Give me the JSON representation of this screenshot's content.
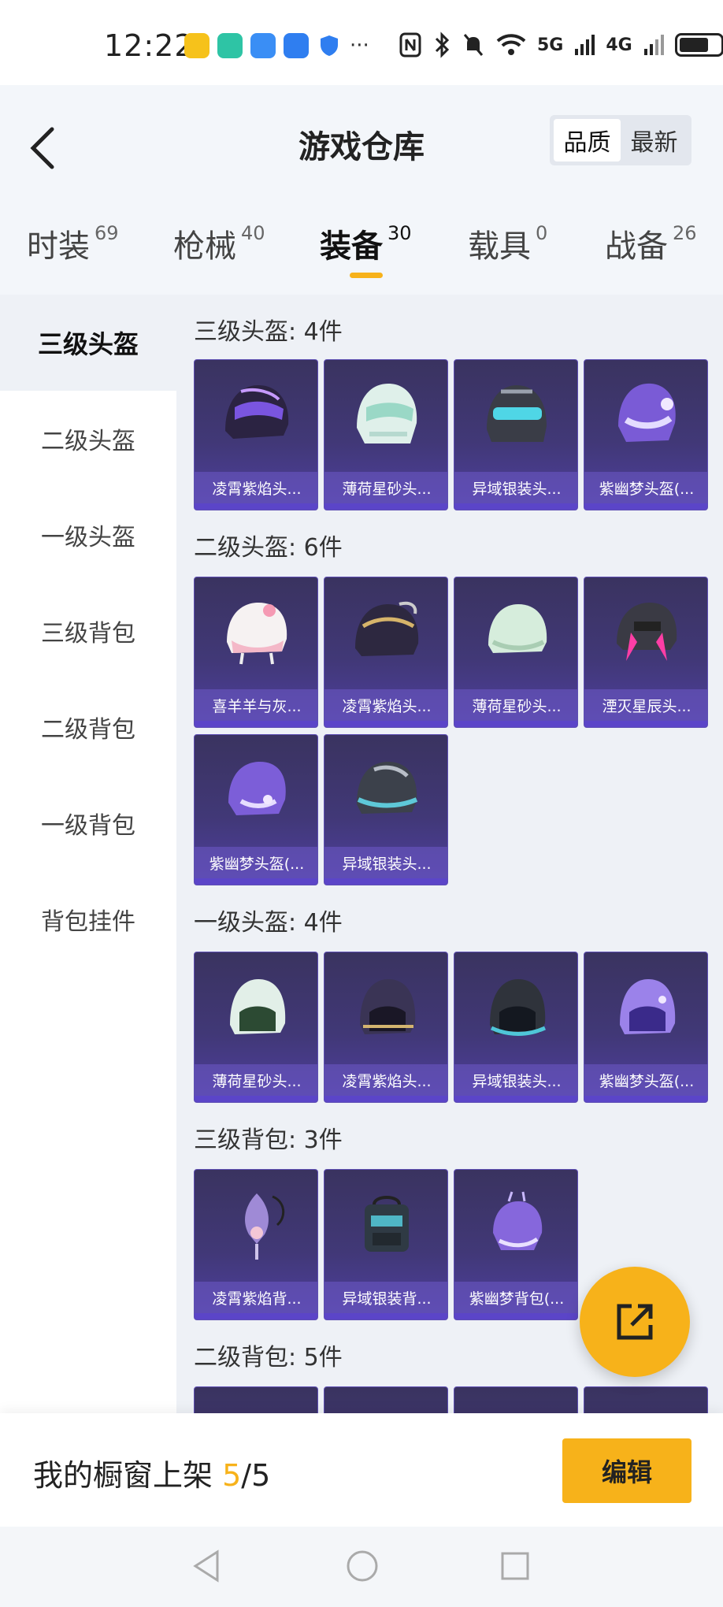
{
  "status": {
    "time": "12:22",
    "net1": "5G",
    "net2": "4G"
  },
  "header": {
    "title": "游戏仓库",
    "sort": [
      "品质",
      "最新"
    ]
  },
  "tabs": [
    {
      "label": "时装",
      "count": "69"
    },
    {
      "label": "枪械",
      "count": "40"
    },
    {
      "label": "装备",
      "count": "30"
    },
    {
      "label": "载具",
      "count": "0"
    },
    {
      "label": "战备",
      "count": "26"
    }
  ],
  "sidebar": [
    "三级头盔",
    "二级头盔",
    "一级头盔",
    "三级背包",
    "二级背包",
    "一级背包",
    "背包挂件"
  ],
  "sections": [
    {
      "title": "三级头盔: 4件",
      "items": [
        "凌霄紫焰头...",
        "薄荷星砂头...",
        "异域银装头...",
        "紫幽梦头盔(..."
      ]
    },
    {
      "title": "二级头盔: 6件",
      "items": [
        "喜羊羊与灰...",
        "凌霄紫焰头...",
        "薄荷星砂头...",
        "湮灭星辰头...",
        "紫幽梦头盔(...",
        "异域银装头..."
      ]
    },
    {
      "title": "一级头盔: 4件",
      "items": [
        "薄荷星砂头...",
        "凌霄紫焰头...",
        "异域银装头...",
        "紫幽梦头盔(..."
      ]
    },
    {
      "title": "三级背包: 3件",
      "items": [
        "凌霄紫焰背...",
        "异域银装背...",
        "紫幽梦背包(..."
      ]
    },
    {
      "title": "二级背包: 5件",
      "items": []
    }
  ],
  "bottom": {
    "shelf_label": "我的橱窗上架 ",
    "shelf_count": "5",
    "shelf_total": "/5",
    "edit": "编辑"
  },
  "colors": {
    "accent": "#f7b21a",
    "card_bg": "#413877"
  }
}
